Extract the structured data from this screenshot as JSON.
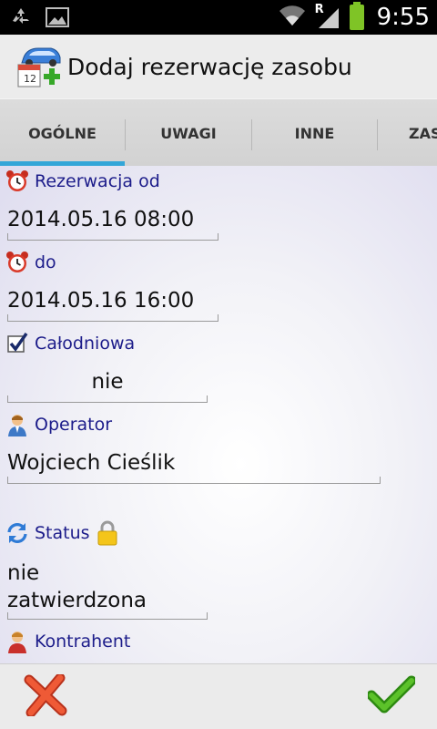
{
  "status_bar": {
    "time": "9:55",
    "left_icons": [
      "recycle-icon",
      "image-icon"
    ],
    "right_icons": [
      "wifi-icon",
      "signal-icon",
      "battery-icon"
    ],
    "roaming_label": "R"
  },
  "title_bar": {
    "title": "Dodaj rezerwację zasobu",
    "icon": "car-calendar-add-icon"
  },
  "tabs": [
    {
      "label": "OGÓLNE",
      "selected": true
    },
    {
      "label": "UWAGI",
      "selected": false
    },
    {
      "label": "INNE",
      "selected": false
    },
    {
      "label": "ZAS",
      "selected": false
    }
  ],
  "form": {
    "rezerwacja_od": {
      "label": "Rezerwacja od",
      "value": "2014.05.16 08:00",
      "icon": "alarm-clock-icon"
    },
    "do": {
      "label": "do",
      "value": "2014.05.16 16:00",
      "icon": "alarm-clock-icon"
    },
    "calodniowa": {
      "label": "Całodniowa",
      "value": "nie",
      "icon": "checkbox-checked-icon"
    },
    "operator": {
      "label": "Operator",
      "value": "Wojciech Cieślik",
      "icon": "user-icon"
    },
    "status": {
      "label": "Status",
      "value_line1": "nie",
      "value_line2": "zatwierdzona",
      "icon": "refresh-icon",
      "lock_icon": "lock-icon"
    },
    "kontrahent": {
      "label": "Kontrahent",
      "icon": "contact-icon"
    }
  },
  "bottom_bar": {
    "cancel": "cancel-icon",
    "confirm": "checkmark-icon"
  },
  "colors": {
    "tab_indicator": "#33a6d8",
    "label_text": "#1c1c8a",
    "cancel_red": "#e8452c",
    "confirm_green": "#4caf1f"
  }
}
